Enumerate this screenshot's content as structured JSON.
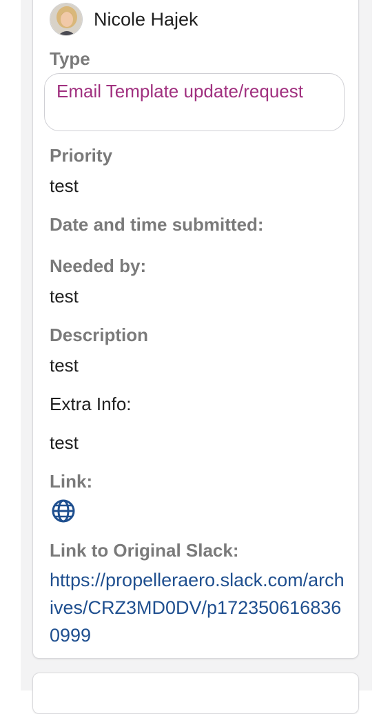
{
  "owner": {
    "name": "Nicole Hajek"
  },
  "fields": {
    "type": {
      "label": "Type",
      "value": "Email Template update/request"
    },
    "priority": {
      "label": "Priority",
      "value": "test"
    },
    "submitted": {
      "label": "Date and time submitted:"
    },
    "needed_by": {
      "label": "Needed by:",
      "value": "test"
    },
    "description": {
      "label": "Description",
      "value": "test"
    },
    "extra_info": {
      "label": "Extra Info:",
      "value": "test"
    },
    "link": {
      "label": "Link:",
      "icon": "globe-icon"
    },
    "slack": {
      "label": "Link to Original Slack:",
      "url": "https://propelleraero.slack.com/archives/CRZ3MD0DV/p1723506168360999"
    }
  },
  "colors": {
    "tag_text": "#a0307f",
    "link_text": "#1f4f8f",
    "label_gray": "#7a7a7a"
  }
}
